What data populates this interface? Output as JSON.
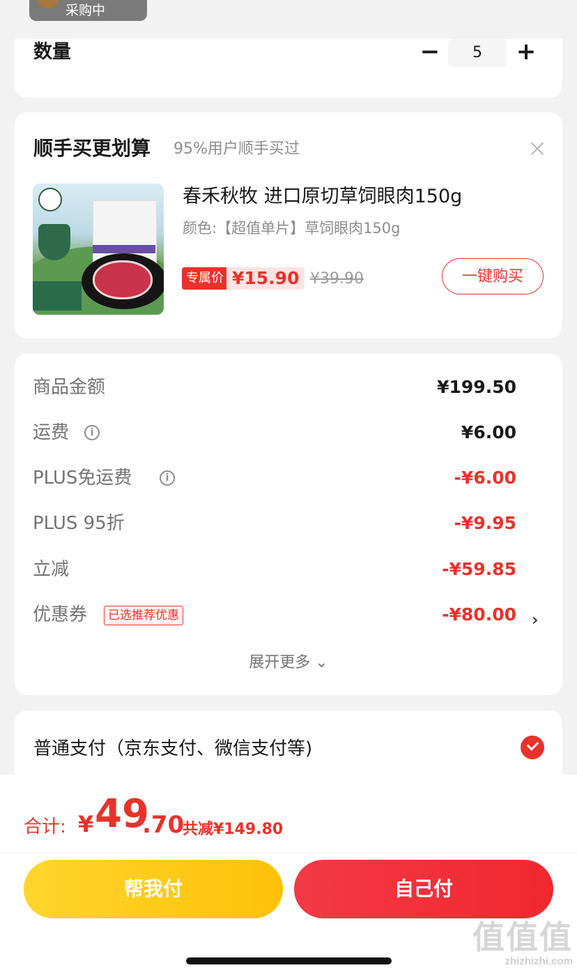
{
  "top": {
    "tag": "采购中"
  },
  "quantity": {
    "label": "数量",
    "minus": "−",
    "value": "5",
    "plus": "+"
  },
  "addon": {
    "title": "顺手买更划算",
    "subtitle": "95%用户顺手买过",
    "product": {
      "name": "春禾秋牧 进口原切草饲眼肉150g",
      "spec": "颜色:【超值单片】草饲眼肉150g",
      "badge": "专属价",
      "price": "¥15.90",
      "original_price": "¥39.90",
      "buy_label": "一键购买"
    }
  },
  "summary": {
    "rows": [
      {
        "label": "商品金额",
        "value": "¥199.50"
      },
      {
        "label": "运费",
        "value": "¥6.00"
      },
      {
        "label": "PLUS免运费",
        "value": "-¥6.00"
      },
      {
        "label": "PLUS 95折",
        "value": "-¥9.95"
      },
      {
        "label": "立减",
        "value": "-¥59.85"
      },
      {
        "label": "优惠券",
        "value": "-¥80.00",
        "tag": "已选推荐优惠"
      }
    ],
    "expand_label": "展开更多 ⌄"
  },
  "payment": {
    "label": "普通支付（京东支付、微信支付等)"
  },
  "bottom": {
    "total_label": "合计:",
    "currency": "¥",
    "total_int": "49",
    "total_dec": ".70",
    "saved": "共减¥149.80",
    "help_pay": "帮我付",
    "self_pay": "自己付"
  },
  "watermark": {
    "logo": "值值值",
    "site": "zhizhizhi.com"
  },
  "colors": {
    "accent": "#e8322b",
    "yellow": "#ffc107"
  }
}
